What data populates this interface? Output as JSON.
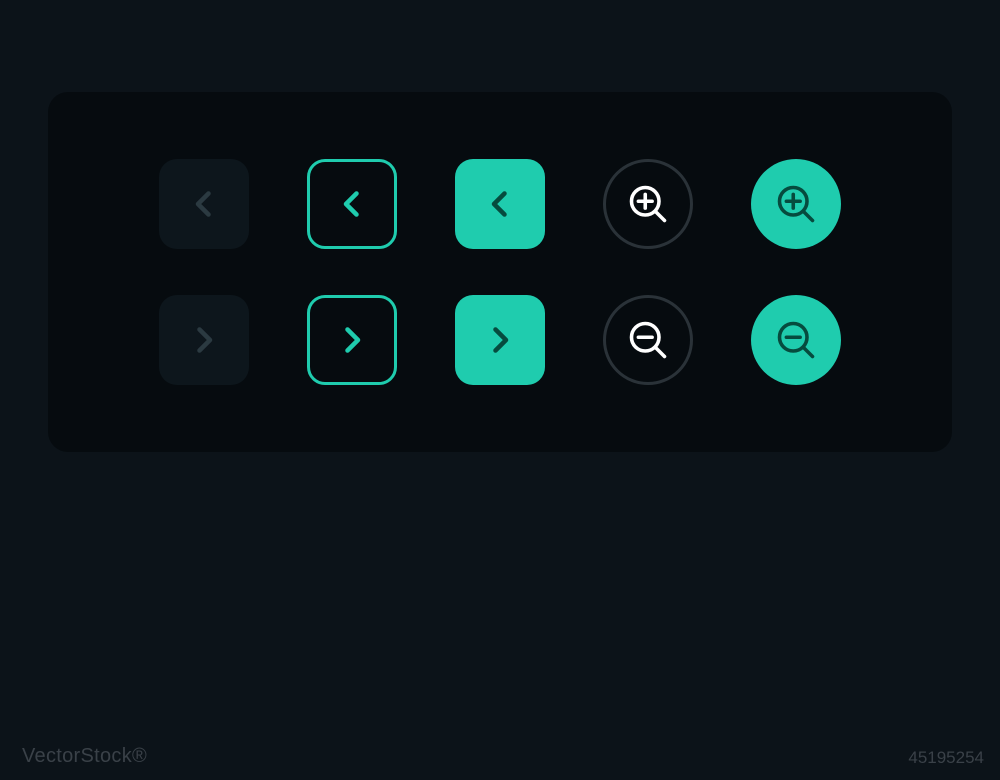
{
  "colors": {
    "teal": "#1fccae",
    "panel": "#060b0f",
    "bg": "#0c1319",
    "muted_icon": "#2b3a41",
    "dark_stroke": "#2a3238",
    "on_teal": "#064b3e",
    "white": "#ffffff"
  },
  "icons": {
    "row1": [
      "chevron-left",
      "chevron-left",
      "chevron-left",
      "zoom-in",
      "zoom-in"
    ],
    "row2": [
      "chevron-right",
      "chevron-right",
      "chevron-right",
      "zoom-out",
      "zoom-out"
    ]
  },
  "watermark": "VectorStock®",
  "image_id": "45195254"
}
